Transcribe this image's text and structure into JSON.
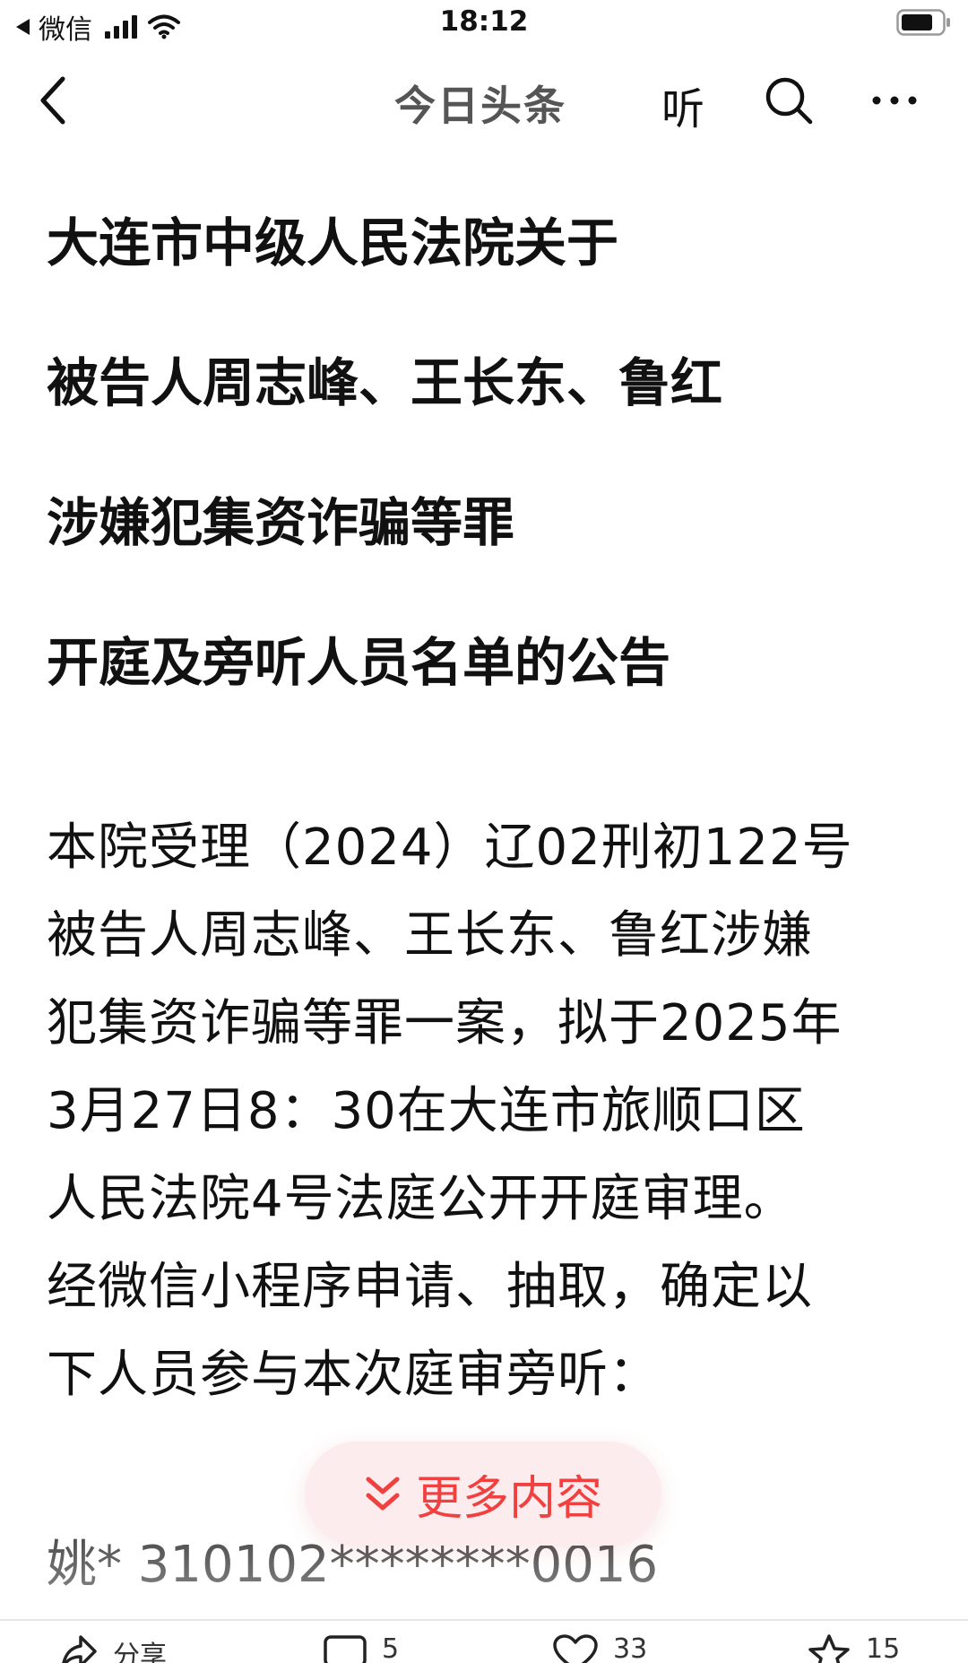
{
  "status_bar": {
    "back_app": "微信",
    "time": "18:12"
  },
  "nav": {
    "title": "今日头条",
    "listen_label": "听",
    "icons": {
      "back": "back-chevron-icon",
      "search": "search-icon",
      "more": "more-dots-icon"
    }
  },
  "article": {
    "headline_lines": [
      "大连市中级人民法院关于",
      "被告人周志峰、王长东、鲁红",
      "涉嫌犯集资诈骗等罪",
      "开庭及旁听人员名单的公告"
    ],
    "body_lines": [
      "本院受理（2024）辽02刑初122号",
      "被告人周志峰、王长东、鲁红涉嫌",
      "犯集资诈骗等罪一案，拟于2025年",
      "3月27日8：30在大连市旅顺口区",
      "人民法院4号法庭公开开庭审理。",
      "经微信小程序申请、抽取，确定以",
      "下人员参与本次庭审旁听："
    ],
    "first_list_entry": "姚* 310102********0016"
  },
  "more_button": {
    "label": "更多内容",
    "color": "#f04040",
    "icon": "double-chevron-down-icon"
  },
  "bottom_bar": {
    "share_label": "分享",
    "comment_count": "5",
    "like_count": "33",
    "favorite_count": "15"
  }
}
